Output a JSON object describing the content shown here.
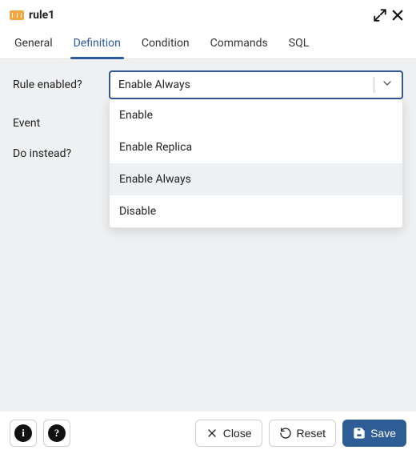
{
  "header": {
    "title": "rule1"
  },
  "tabs": [
    {
      "id": "general",
      "label": "General"
    },
    {
      "id": "definition",
      "label": "Definition"
    },
    {
      "id": "condition",
      "label": "Condition"
    },
    {
      "id": "commands",
      "label": "Commands"
    },
    {
      "id": "sql",
      "label": "SQL"
    }
  ],
  "active_tab": "definition",
  "form": {
    "rule_enabled": {
      "label": "Rule enabled?",
      "value": "Enable Always",
      "options": [
        "Enable",
        "Enable Replica",
        "Enable Always",
        "Disable"
      ],
      "highlighted_option": "Enable Always"
    },
    "event": {
      "label": "Event"
    },
    "do_instead": {
      "label": "Do instead?"
    }
  },
  "footer": {
    "close_label": "Close",
    "reset_label": "Reset",
    "save_label": "Save"
  }
}
